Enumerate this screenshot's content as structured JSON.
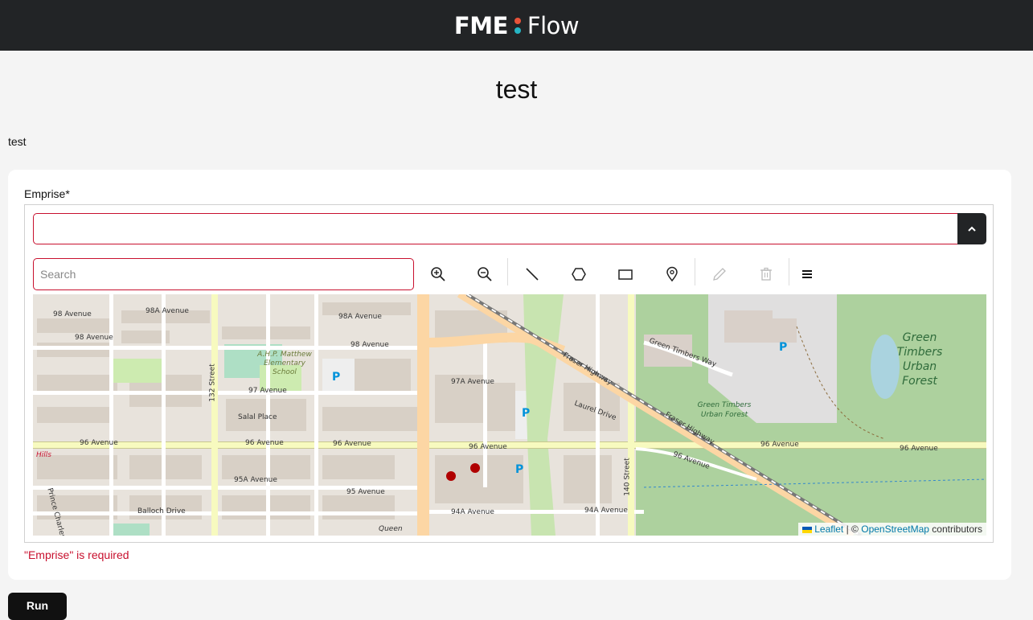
{
  "header": {
    "logo_left": "FME",
    "logo_right": "Flow",
    "logo_dot_colors": [
      "#e8533a",
      "#26b5c4"
    ]
  },
  "page": {
    "title": "test",
    "description": "test"
  },
  "form": {
    "field_label": "Emprise*",
    "geometry_value": "",
    "search_placeholder": "Search",
    "error_message": "\"Emprise\" is required",
    "run_label": "Run"
  },
  "toolbar": {
    "tools": [
      "zoom-in-icon",
      "zoom-out-icon",
      "draw-line-icon",
      "draw-polygon-icon",
      "draw-rectangle-icon",
      "draw-point-icon",
      "edit-icon",
      "delete-icon",
      "menu-icon"
    ]
  },
  "map": {
    "attribution_leaflet": "Leaflet",
    "attribution_sep": "| ©",
    "attribution_osm": "OpenStreetMap",
    "attribution_suffix": "contributors",
    "labels": {
      "a98": "98 Avenue",
      "a98a": "98A Avenue",
      "a98a_east": "98A Avenue",
      "a98_mid": "98 Avenue",
      "a98_east": "98 Avenue",
      "a97": "97 Avenue",
      "a97a": "97A Avenue",
      "a96_1": "96 Avenue",
      "a96_2": "96 Avenue",
      "a96_3": "96 Avenue",
      "a96_4": "96 Avenue",
      "a96_5": "96 Avenue",
      "a96_6": "96 Avenue",
      "a96_7": "96 Avenue",
      "a95a": "95A Avenue",
      "a95": "95 Avenue",
      "a94a": "94A Avenue",
      "a94a_east": "94A Avenue",
      "s132": "132 Street",
      "s140": "140 Street",
      "school": "A.H.P. Matthew Elementary School",
      "salal": "Salal Place",
      "balloch": "Balloch Drive",
      "laurel": "Laurel Drive",
      "gtway": "Green Timbers Way",
      "fraser1": "Fraser Highway",
      "fraser2": "Fraser Highway",
      "gt_forest_big": "Green Timbers Urban Forest",
      "gt_forest_small": "Green Timbers Urban Forest",
      "hills": "Hills",
      "queen": "Queen",
      "prince": "Prince Charles Boulevard",
      "parking": "P"
    }
  }
}
